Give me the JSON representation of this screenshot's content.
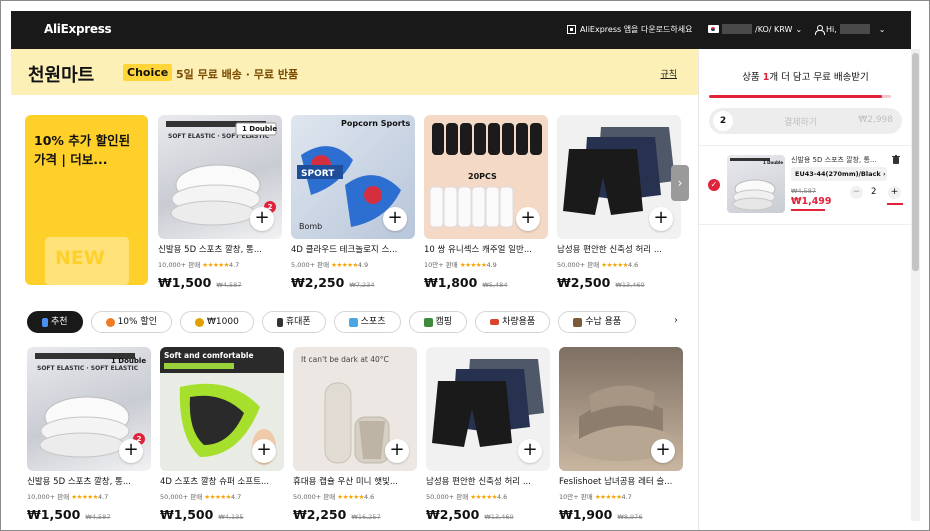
{
  "topbar": {
    "logo": "AliExpress",
    "download_app": "AliExpress 앱을 다운로드하세요",
    "locale": "/KO/ KRW",
    "greeting": "Hi,"
  },
  "banner": {
    "title": "천원마트",
    "badge": "Choice",
    "subtitle": "5일 무료 배송 · 무료 반품",
    "rules_link": "규칙"
  },
  "promo": {
    "text": "10% 추가 할인된 가격 | 더보...",
    "sign": "NEW"
  },
  "row1": [
    {
      "name": "신발용 5D 스포츠 깔창, 통...",
      "sold": "10,000+ 판매",
      "rating": "4.7",
      "price": "₩1,500",
      "was": "₩4,587",
      "badge": "2",
      "img_label": "1 Double"
    },
    {
      "name": "4D 클라우드 테크놀로지 스...",
      "sold": "5,000+ 판매",
      "rating": "4.9",
      "price": "₩2,250",
      "was": "₩7,234",
      "img_label": "Popcorn Sports"
    },
    {
      "name": "10 쌍 유니섹스 캐주얼 일반...",
      "sold": "10만+ 판매",
      "rating": "4.9",
      "price": "₩1,800",
      "was": "₩5,484",
      "img_label": "20PCS"
    },
    {
      "name": "남성용 편안한 신축성 허리 ...",
      "sold": "50,000+ 판매",
      "rating": "4.6",
      "price": "₩2,500",
      "was": "₩13,460"
    }
  ],
  "chips": [
    "추천",
    "10% 할인",
    "₩1000",
    "휴대폰",
    "스포츠",
    "캠핑",
    "차량용품",
    "수납 용품"
  ],
  "row2": [
    {
      "name": "신발용 5D 스포츠 깔창, 통...",
      "sold": "10,000+ 판매",
      "rating": "4.7",
      "price": "₩1,500",
      "was": "₩4,587",
      "badge": "2",
      "img_label": "1 Double"
    },
    {
      "name": "4D 스포츠 깔창 슈퍼 소프트...",
      "sold": "50,000+ 판매",
      "rating": "4.7",
      "price": "₩1,500",
      "was": "₩4,135",
      "img_label": "Soft and comfortable"
    },
    {
      "name": "휴대용 캡슐 우산 미니 햇빛...",
      "sold": "50,000+ 판매",
      "rating": "4.6",
      "price": "₩2,250",
      "was": "₩16,257",
      "img_label": "It can't be dark at 40°C"
    },
    {
      "name": "남성용 편안한 신축성 허리 ...",
      "sold": "50,000+ 판매",
      "rating": "4.6",
      "price": "₩2,500",
      "was": "₩13,460"
    },
    {
      "name": "Feslishoet 남녀공용 레터 슬...",
      "sold": "10만+ 판매",
      "rating": "4.7",
      "price": "₩1,900",
      "was": "₩8,976"
    }
  ],
  "side": {
    "title_prefix": "상품 ",
    "title_count": "1",
    "title_suffix": "개 더 담고 무료 배송받기",
    "progress": 0.95,
    "cart_count": "2",
    "checkout_label": "결제하기",
    "checkout_amount": "₩2,998",
    "item": {
      "name": "신발용 5D 스포츠 깔창, 통...",
      "variant": "EU43-44(270mm)/Black",
      "was": "₩4,587",
      "price": "₩1,499",
      "qty": "2",
      "img_label": "1 Double"
    }
  },
  "colors": {
    "accent": "#e0223a",
    "banner": "#fdf0b6",
    "topbar": "#191919",
    "star": "#f5a400",
    "promo": "#ffd02a"
  }
}
